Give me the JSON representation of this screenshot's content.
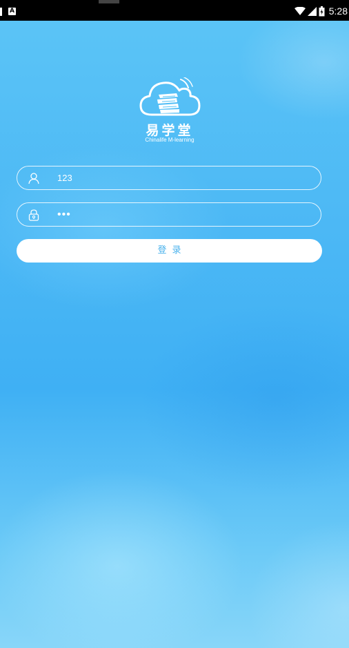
{
  "status_bar": {
    "time": "5:28",
    "left_icon": "a-notification-icon",
    "right_icons": [
      "wifi-icon",
      "signal-icon",
      "battery-icon"
    ]
  },
  "logo": {
    "icon": "cloud-book-icon",
    "title": "易学堂",
    "subtitle": "Chinalife M-learning"
  },
  "form": {
    "username": {
      "icon": "user-icon",
      "value": "123"
    },
    "password": {
      "icon": "lock-icon",
      "value": "•••"
    },
    "login_label": "登录"
  },
  "colors": {
    "background": "#4cb8f5",
    "button_text": "#4ab2ec"
  }
}
